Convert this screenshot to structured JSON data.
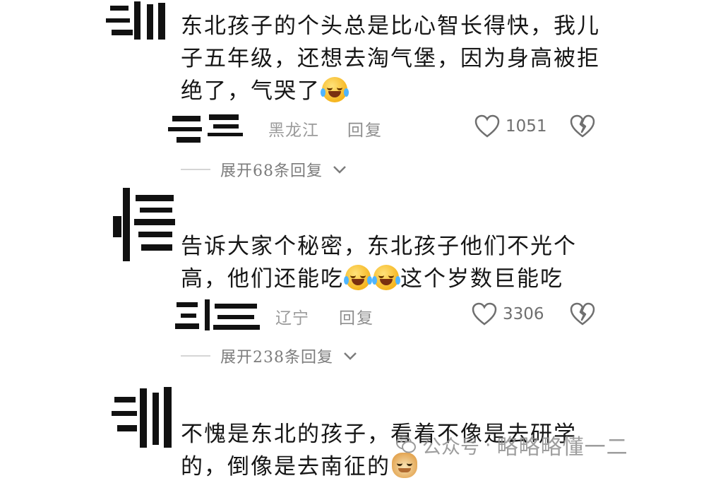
{
  "comments": [
    {
      "avatar_text": "郑",
      "text_lines": [
        "东北孩子的个头总是比心智长得快，我儿",
        "子五年级，还想去淘气堡，因为身高被拒",
        "绝了，气哭了"
      ],
      "emoji_end": "laugh-cry-emoji",
      "region": "黑龙江",
      "reply_label": "回复",
      "likes": "1051",
      "expand_label": "展开68条回复"
    },
    {
      "avatar_text": "嬉",
      "text_lines": [
        "告诉大家个秘密，东北孩子他们不光个",
        "高，他们还能吃",
        "这个岁数巨能吃"
      ],
      "emoji_mid": [
        "rofl-emoji",
        "rofl-emoji"
      ],
      "region": "辽宁",
      "reply_label": "回复",
      "likes": "3306",
      "expand_label": "展开238条回复"
    },
    {
      "avatar_text": "郑",
      "text_lines": [
        "不愧是东北的孩子，看着不像是去研学",
        "的，倒像是去南征的"
      ],
      "emoji_end": "doge-emoji"
    }
  ],
  "watermark": {
    "prefix": "公众号",
    "separator": "·",
    "name": "略略略懂一二"
  },
  "colors": {
    "text": "#161616",
    "meta": "#9b9b9b",
    "icon": "#6f6f6f",
    "watermark": "#8c8c8c"
  }
}
